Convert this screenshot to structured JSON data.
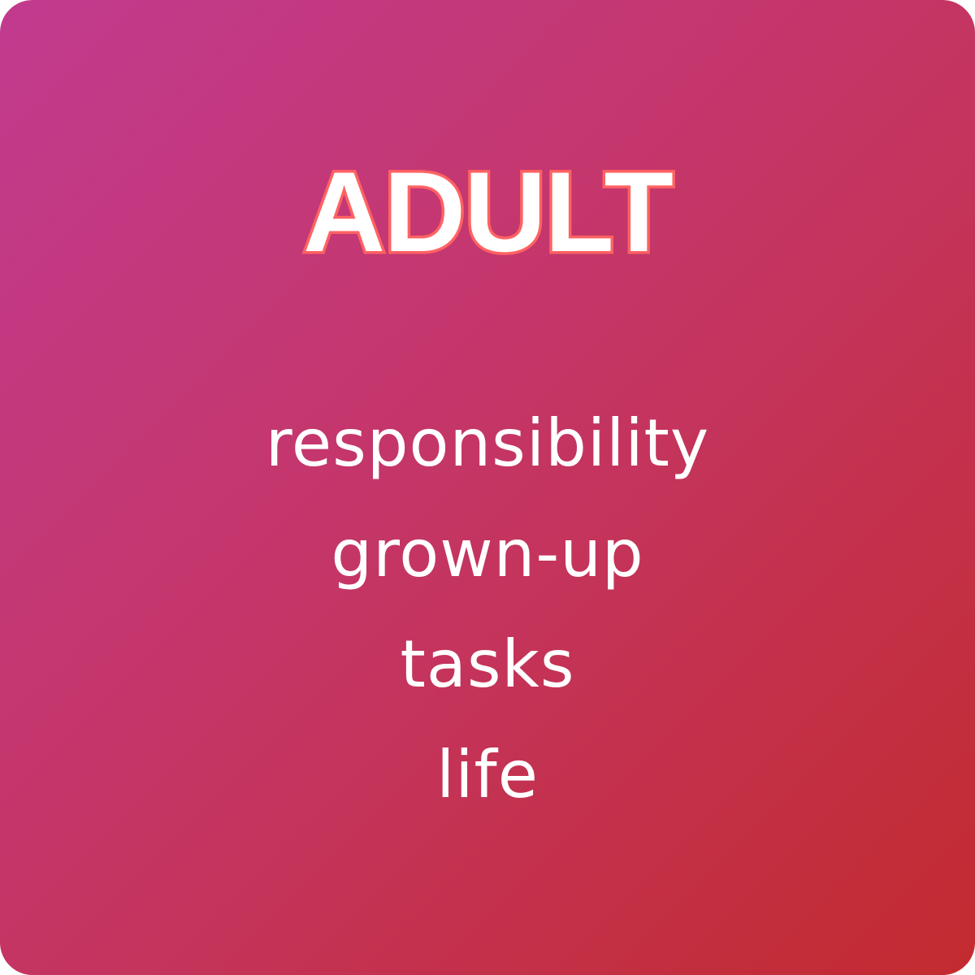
{
  "card": {
    "title": "ADULT",
    "words": [
      "responsibility",
      "grown-up",
      "tasks",
      "life"
    ]
  },
  "colors": {
    "gradient_start": "#c23a8f",
    "gradient_end": "#c32b2f",
    "title_outline": "#ff6262",
    "text": "#ffffff"
  }
}
